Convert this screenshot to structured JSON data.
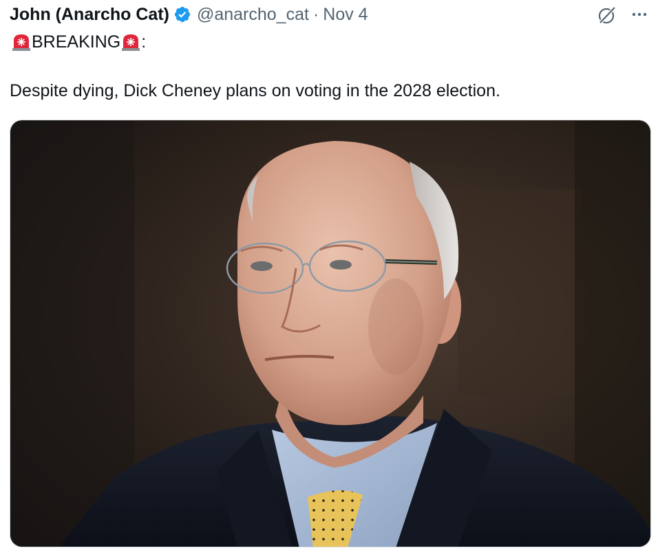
{
  "author": {
    "display_name": "John (Anarcho Cat)",
    "handle": "@anarcho_cat",
    "separator": "·",
    "date": "Nov 4",
    "verified_color": "#1d9bf0"
  },
  "tweet": {
    "headline_text": "BREAKING",
    "headline_suffix": ":",
    "body": "Despite dying, Dick Cheney plans on voting in the 2028 election."
  },
  "icons": {
    "verified": "verified-badge-icon",
    "grok": "grok-icon",
    "more": "more-options-icon",
    "siren": "siren-emoji-icon"
  },
  "media": {
    "type": "photo"
  }
}
